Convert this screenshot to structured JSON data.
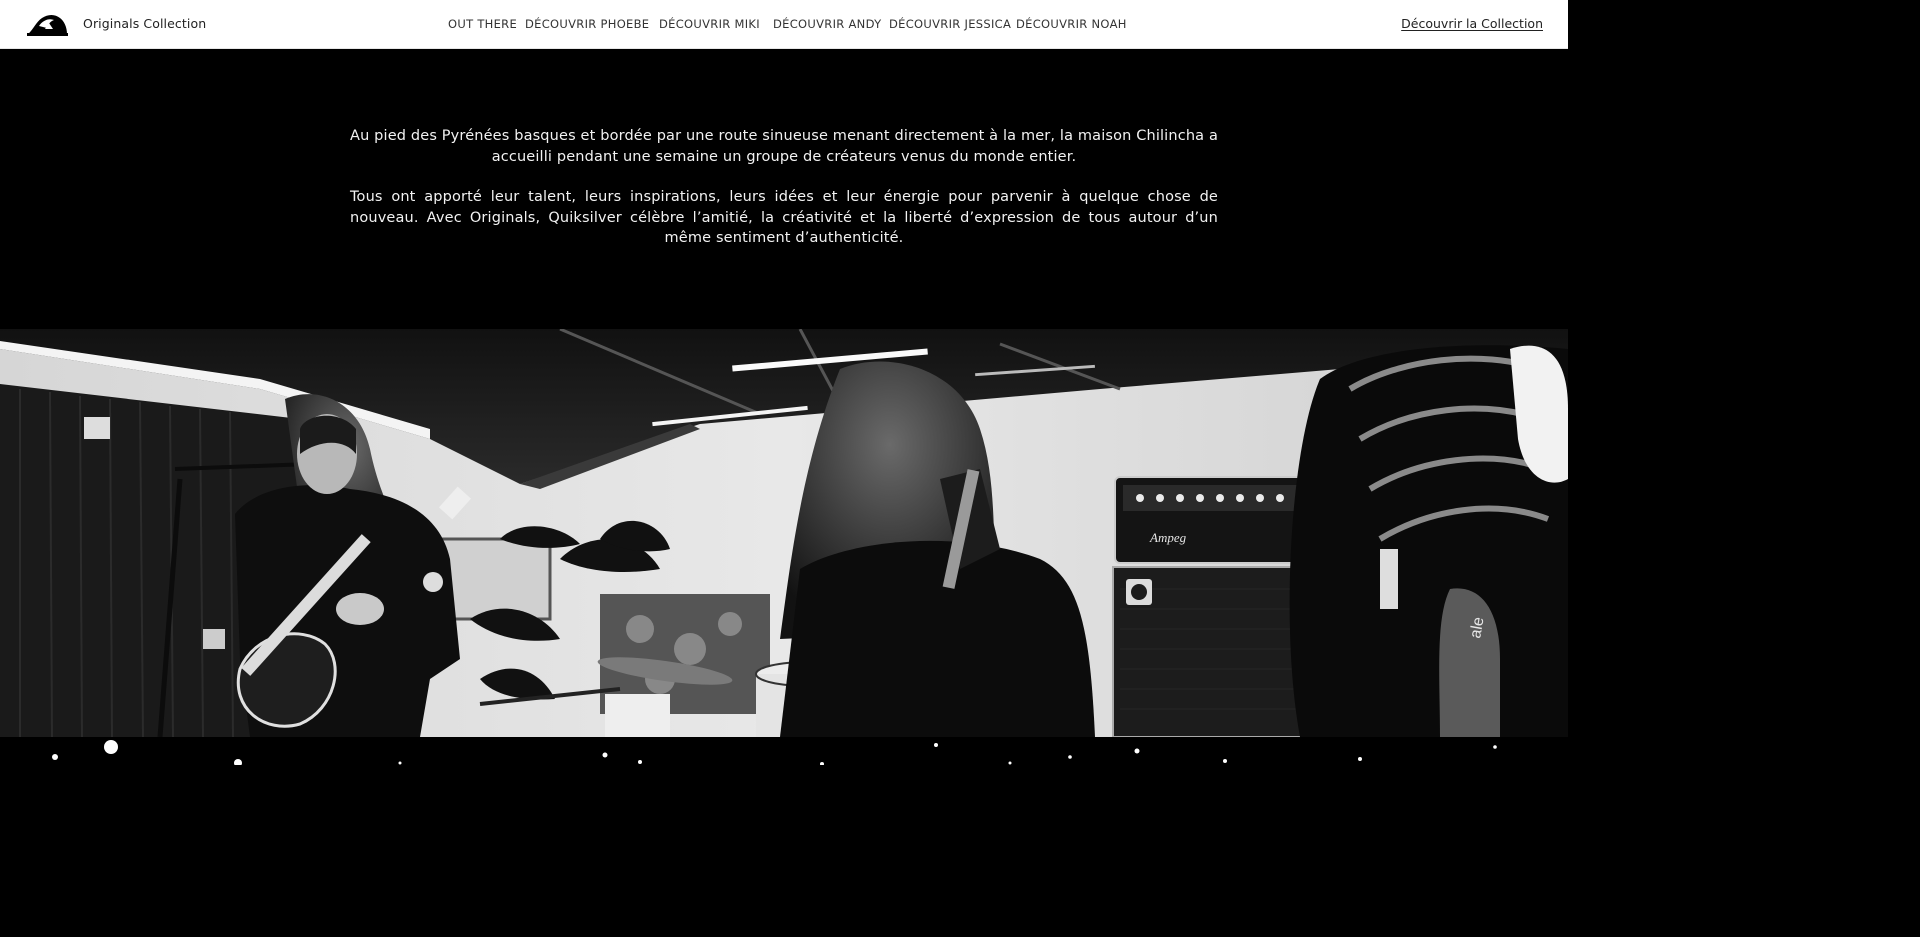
{
  "header": {
    "brand_label": "Originals Collection",
    "logo": "quiksilver-wave-logo",
    "nav": [
      {
        "label": "OUT THERE"
      },
      {
        "label": "DÉCOUVRIR PHOEBE"
      },
      {
        "label": "DÉCOUVRIR MIKI"
      },
      {
        "label": "DÉCOUVRIR ANDY"
      },
      {
        "label": "DÉCOUVRIR JESSICA"
      },
      {
        "label": "DÉCOUVRIR NOAH"
      }
    ],
    "cta_label": "Découvrir la Collection"
  },
  "intro": {
    "paragraphs": [
      "Au pied des Pyrénées basques et bordée par une route sinueuse menant directement à la mer, la maison Chilincha a accueilli pendant une semaine un groupe de créateurs venus du monde entier.",
      "Tous ont apporté leur talent, leurs inspirations, leurs idées et leur énergie pour parvenir à quelque chose de nouveau. Avec Originals, Quiksilver célèbre l’amitié, la créativité et la liberté d’expression de tous autour d’un même sentiment d’authenticité."
    ]
  },
  "photo": {
    "amp_brand_text": "Ampeg",
    "board_text": "ale"
  },
  "colors": {
    "header_bg": "#ffffff",
    "page_bg": "#000000",
    "text_light": "#f2f2f2",
    "text_dark": "#222222"
  }
}
